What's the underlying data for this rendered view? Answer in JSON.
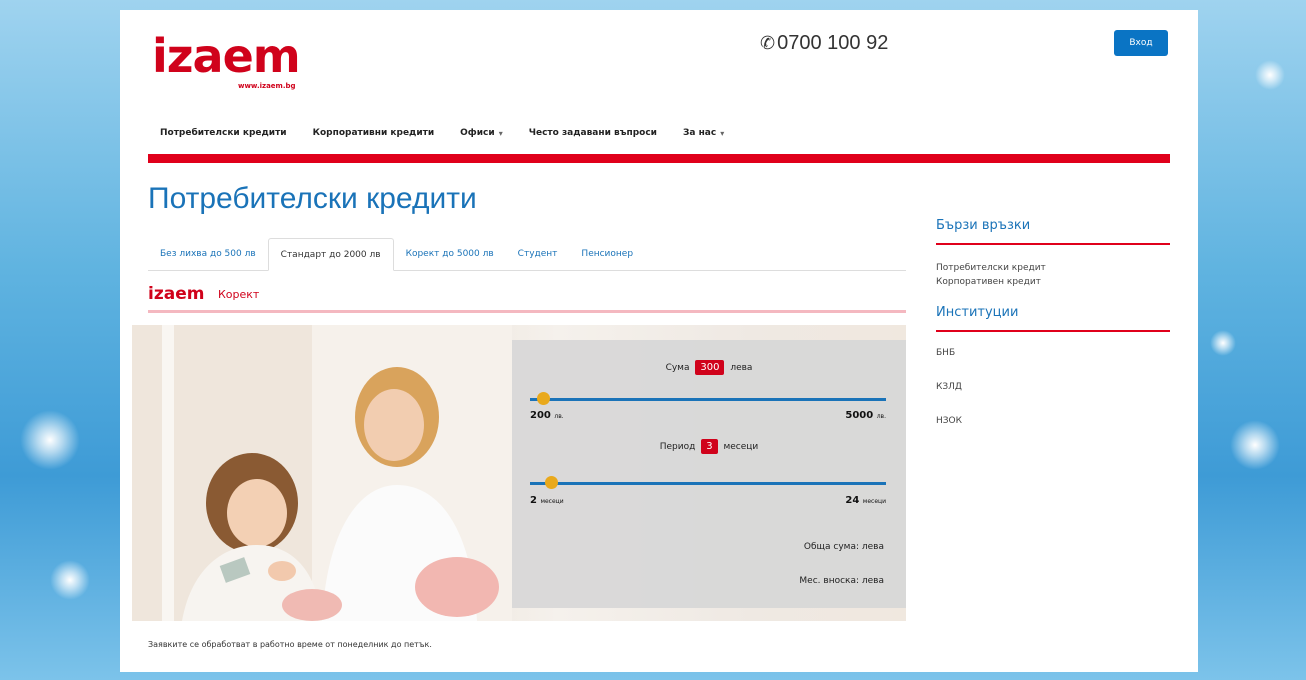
{
  "header": {
    "logo_text": "izaem",
    "logo_url": "www.izaem.bg",
    "phone": "0700 100 92",
    "login_label": "Вход"
  },
  "nav": {
    "items": [
      {
        "label": "Потребителски кредити",
        "dropdown": false
      },
      {
        "label": "Корпоративни кредити",
        "dropdown": false
      },
      {
        "label": "Офиси",
        "dropdown": true
      },
      {
        "label": "Често задавани въпроси",
        "dropdown": false
      },
      {
        "label": "За нас",
        "dropdown": true
      }
    ]
  },
  "main": {
    "title": "Потребителски кредити",
    "tabs": [
      {
        "label": "Без лихва до 500 лв",
        "active": false
      },
      {
        "label": "Стандарт до 2000 лв",
        "active": true
      },
      {
        "label": "Корект до 5000 лв",
        "active": false
      },
      {
        "label": "Студент",
        "active": false
      },
      {
        "label": "Пенсионер",
        "active": false
      }
    ],
    "product": {
      "brand": "izaem",
      "name": "Корект"
    },
    "calculator": {
      "amount_label": "Сума",
      "amount_value": "300",
      "amount_unit": "лева",
      "amount_min": "200",
      "amount_min_unit": "лв.",
      "amount_max": "5000",
      "amount_max_unit": "лв.",
      "amount_fraction": 0.02,
      "period_label": "Период",
      "period_value": "3",
      "period_unit": "месеци",
      "period_min": "2",
      "period_min_unit": "месеци",
      "period_max": "24",
      "period_max_unit": "месеци",
      "period_fraction": 0.045,
      "total_label": "Обща сума: лева",
      "installment_label": "Мес. вноска: лева"
    },
    "notice": "Заявките се обработват в работно време от понеделник до петък."
  },
  "sidebar": {
    "quick_links_title": "Бързи връзки",
    "quick_links": [
      "Потребителски кредит",
      "Корпоративен кредит"
    ],
    "institutions_title": "Институции",
    "institutions": [
      "БНБ",
      "КЗЛД",
      "НЗОК"
    ]
  },
  "colors": {
    "brand_red": "#d0021b",
    "brand_blue": "#1a73b8",
    "slider_thumb": "#e9a91c"
  }
}
